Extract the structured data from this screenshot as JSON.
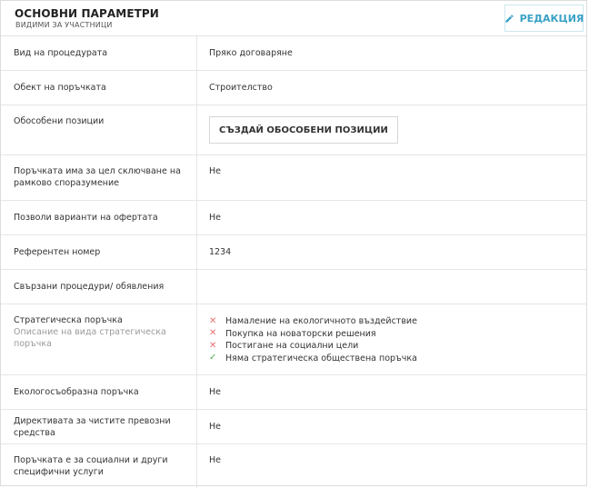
{
  "header": {
    "title": "ОСНОВНИ ПАРАМЕТРИ",
    "subtitle": "ВИДИМИ ЗА УЧАСТНИЦИ",
    "edit_label": "РЕДАКЦИЯ"
  },
  "colors": {
    "accent": "#3aa1c6",
    "cross": "#e57373",
    "check": "#4caf50"
  },
  "rows": {
    "procedure_type": {
      "label": "Вид на процедурата",
      "value": "Пряко договаряне"
    },
    "subject": {
      "label": "Обект на поръчката",
      "value": "Строителство"
    },
    "separate_positions": {
      "label": "Обособени позиции",
      "button": "СЪЗДАЙ ОБОСОБЕНИ ПОЗИЦИИ"
    },
    "framework": {
      "label": "Поръчката има за цел сключване на рамково споразумение",
      "value": "Не"
    },
    "variants": {
      "label": "Позволи варианти на офертата",
      "value": "Не"
    },
    "reference": {
      "label": "Референтен номер",
      "value": "1234"
    },
    "related": {
      "label": "Свързани процедури/ обявления",
      "value": ""
    },
    "strategic": {
      "label": "Стратегическа поръчка",
      "hint": "Описание на вида стратегическа поръчка",
      "items": [
        {
          "text": "Намаление на екологичното въздействие",
          "state": "cross",
          "icon": "cross-icon"
        },
        {
          "text": "Покупка на новаторски решения",
          "state": "cross",
          "icon": "cross-icon"
        },
        {
          "text": "Постигане на социални цели",
          "state": "cross",
          "icon": "cross-icon"
        },
        {
          "text": "Няма стратегическа обществена поръчка",
          "state": "check",
          "icon": "check-icon"
        }
      ]
    },
    "eco": {
      "label": "Екологосъобразна поръчка",
      "value": "Не"
    },
    "clean_vehicles": {
      "label": "Директивата за чистите превозни средства",
      "value": "Не"
    },
    "social": {
      "label": "Поръчката е за социални и други специфични услуги",
      "value": "Не"
    }
  }
}
